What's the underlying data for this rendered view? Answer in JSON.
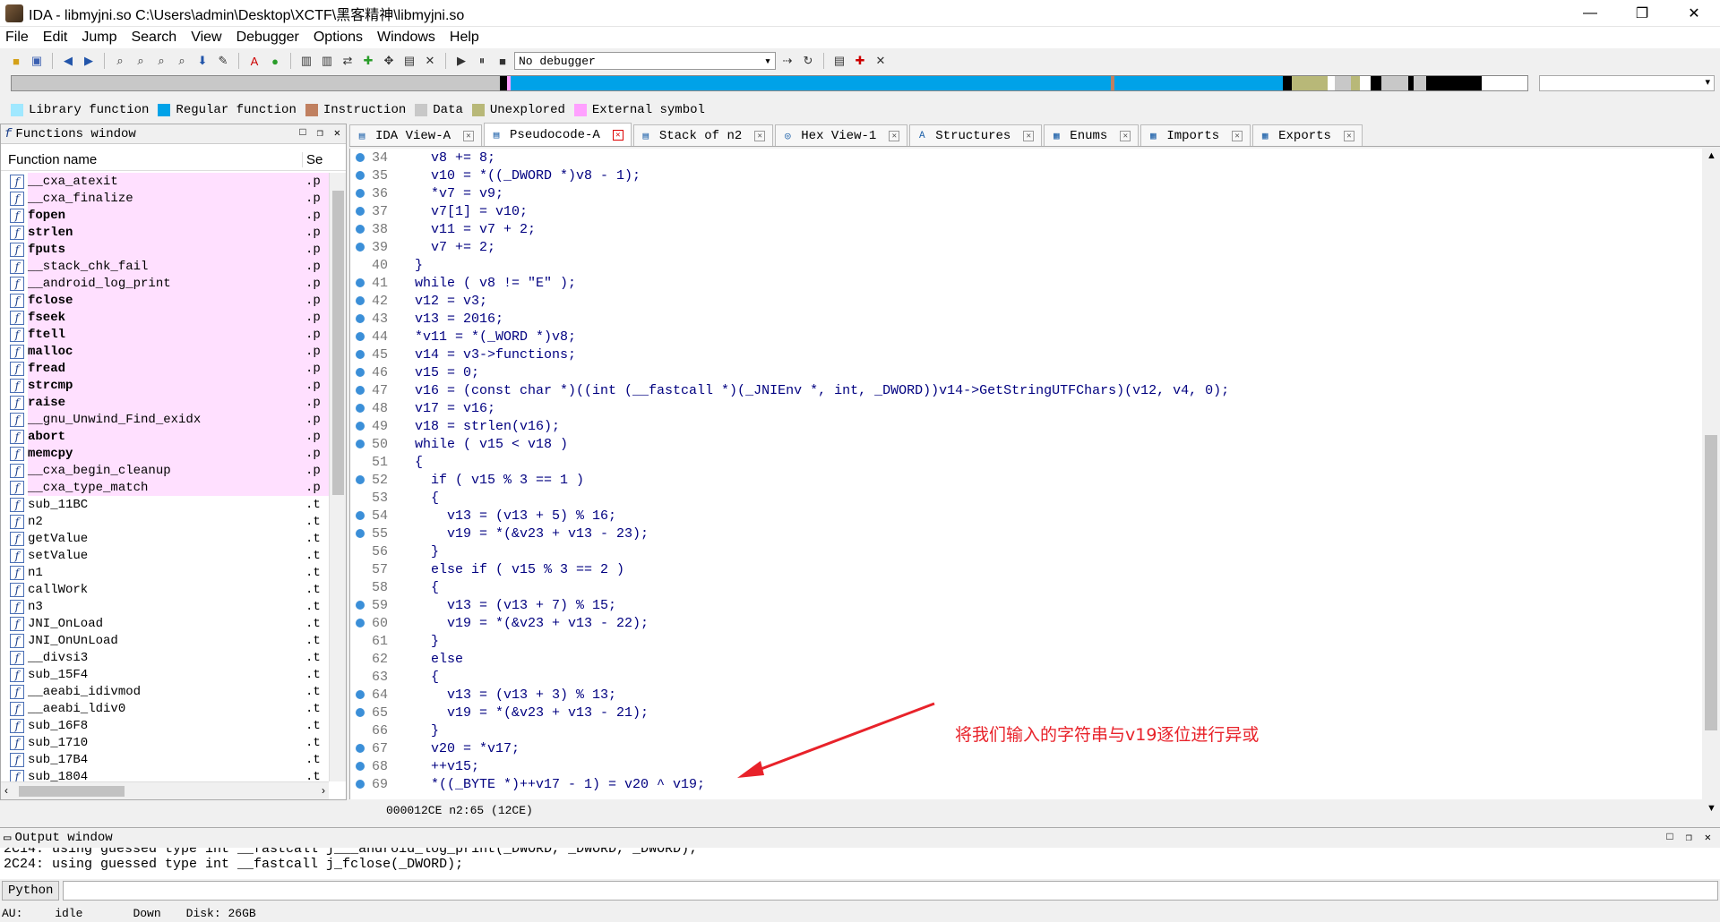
{
  "window": {
    "title": "IDA - libmyjni.so C:\\Users\\admin\\Desktop\\XCTF\\黑客精神\\libmyjni.so",
    "minimize": "—",
    "maximize": "❐",
    "close": "✕"
  },
  "menu": [
    "File",
    "Edit",
    "Jump",
    "Search",
    "View",
    "Debugger",
    "Options",
    "Windows",
    "Help"
  ],
  "toolbar": {
    "debugger_value": "No debugger"
  },
  "nav_selector": "▾",
  "legend": [
    {
      "label": "Library function",
      "color": "#a0e8ff"
    },
    {
      "label": "Regular function",
      "color": "#00a2e8"
    },
    {
      "label": "Instruction",
      "color": "#c08060"
    },
    {
      "label": "Data",
      "color": "#c8c8c8"
    },
    {
      "label": "Unexplored",
      "color": "#b8b878"
    },
    {
      "label": "External symbol",
      "color": "#ffa0ff"
    }
  ],
  "functions_window": {
    "title": "Functions window",
    "col_name": "Function name",
    "col_seg": "Se",
    "items": [
      {
        "name": "__cxa_atexit",
        "seg": ".p",
        "imp": true,
        "bold": false
      },
      {
        "name": "__cxa_finalize",
        "seg": ".p",
        "imp": true,
        "bold": false
      },
      {
        "name": "fopen",
        "seg": ".p",
        "imp": true,
        "bold": true
      },
      {
        "name": "strlen",
        "seg": ".p",
        "imp": true,
        "bold": true
      },
      {
        "name": "fputs",
        "seg": ".p",
        "imp": true,
        "bold": true
      },
      {
        "name": "__stack_chk_fail",
        "seg": ".p",
        "imp": true,
        "bold": false
      },
      {
        "name": "__android_log_print",
        "seg": ".p",
        "imp": true,
        "bold": false
      },
      {
        "name": "fclose",
        "seg": ".p",
        "imp": true,
        "bold": true
      },
      {
        "name": "fseek",
        "seg": ".p",
        "imp": true,
        "bold": true
      },
      {
        "name": "ftell",
        "seg": ".p",
        "imp": true,
        "bold": true
      },
      {
        "name": "malloc",
        "seg": ".p",
        "imp": true,
        "bold": true
      },
      {
        "name": "fread",
        "seg": ".p",
        "imp": true,
        "bold": true
      },
      {
        "name": "strcmp",
        "seg": ".p",
        "imp": true,
        "bold": true
      },
      {
        "name": "raise",
        "seg": ".p",
        "imp": true,
        "bold": true
      },
      {
        "name": "__gnu_Unwind_Find_exidx",
        "seg": ".p",
        "imp": true,
        "bold": false
      },
      {
        "name": "abort",
        "seg": ".p",
        "imp": true,
        "bold": true
      },
      {
        "name": "memcpy",
        "seg": ".p",
        "imp": true,
        "bold": true
      },
      {
        "name": "__cxa_begin_cleanup",
        "seg": ".p",
        "imp": true,
        "bold": false
      },
      {
        "name": "__cxa_type_match",
        "seg": ".p",
        "imp": true,
        "bold": false
      },
      {
        "name": "sub_11BC",
        "seg": ".t",
        "imp": false,
        "bold": false
      },
      {
        "name": "n2",
        "seg": ".t",
        "imp": false,
        "bold": false
      },
      {
        "name": "getValue",
        "seg": ".t",
        "imp": false,
        "bold": false
      },
      {
        "name": "setValue",
        "seg": ".t",
        "imp": false,
        "bold": false
      },
      {
        "name": "n1",
        "seg": ".t",
        "imp": false,
        "bold": false
      },
      {
        "name": "callWork",
        "seg": ".t",
        "imp": false,
        "bold": false
      },
      {
        "name": "n3",
        "seg": ".t",
        "imp": false,
        "bold": false
      },
      {
        "name": "JNI_OnLoad",
        "seg": ".t",
        "imp": false,
        "bold": false
      },
      {
        "name": "JNI_OnUnLoad",
        "seg": ".t",
        "imp": false,
        "bold": false
      },
      {
        "name": "__divsi3",
        "seg": ".t",
        "imp": false,
        "bold": false
      },
      {
        "name": "sub_15F4",
        "seg": ".t",
        "imp": false,
        "bold": false
      },
      {
        "name": "__aeabi_idivmod",
        "seg": ".t",
        "imp": false,
        "bold": false
      },
      {
        "name": "__aeabi_ldiv0",
        "seg": ".t",
        "imp": false,
        "bold": false
      },
      {
        "name": "sub_16F8",
        "seg": ".t",
        "imp": false,
        "bold": false
      },
      {
        "name": "sub_1710",
        "seg": ".t",
        "imp": false,
        "bold": false
      },
      {
        "name": "sub_17B4",
        "seg": ".t",
        "imp": false,
        "bold": false
      },
      {
        "name": "sub_1804",
        "seg": ".t",
        "imp": false,
        "bold": false
      }
    ]
  },
  "tabs": [
    {
      "label": "IDA View-A",
      "icon": "▤",
      "active": false
    },
    {
      "label": "Pseudocode-A",
      "icon": "▤",
      "active": true
    },
    {
      "label": "Stack of n2",
      "icon": "▤",
      "active": false
    },
    {
      "label": "Hex View-1",
      "icon": "◎",
      "active": false
    },
    {
      "label": "Structures",
      "icon": "A",
      "active": false
    },
    {
      "label": "Enums",
      "icon": "▦",
      "active": false
    },
    {
      "label": "Imports",
      "icon": "▦",
      "active": false
    },
    {
      "label": "Exports",
      "icon": "▦",
      "active": false
    }
  ],
  "code": [
    {
      "n": "34",
      "dot": true,
      "t": "    v8 += 8;"
    },
    {
      "n": "35",
      "dot": true,
      "t": "    v10 = *((_DWORD *)v8 - 1);"
    },
    {
      "n": "36",
      "dot": true,
      "t": "    *v7 = v9;"
    },
    {
      "n": "37",
      "dot": true,
      "t": "    v7[1] = v10;"
    },
    {
      "n": "38",
      "dot": true,
      "t": "    v11 = v7 + 2;"
    },
    {
      "n": "39",
      "dot": true,
      "t": "    v7 += 2;"
    },
    {
      "n": "40",
      "dot": false,
      "t": "  }"
    },
    {
      "n": "41",
      "dot": true,
      "t": "  while ( v8 != \"E\" );"
    },
    {
      "n": "42",
      "dot": true,
      "t": "  v12 = v3;"
    },
    {
      "n": "43",
      "dot": true,
      "t": "  v13 = 2016;"
    },
    {
      "n": "44",
      "dot": true,
      "t": "  *v11 = *(_WORD *)v8;"
    },
    {
      "n": "45",
      "dot": true,
      "t": "  v14 = v3->functions;"
    },
    {
      "n": "46",
      "dot": true,
      "t": "  v15 = 0;"
    },
    {
      "n": "47",
      "dot": true,
      "t": "  v16 = (const char *)((int (__fastcall *)(_JNIEnv *, int, _DWORD))v14->GetStringUTFChars)(v12, v4, 0);"
    },
    {
      "n": "48",
      "dot": true,
      "t": "  v17 = v16;"
    },
    {
      "n": "49",
      "dot": true,
      "t": "  v18 = strlen(v16);"
    },
    {
      "n": "50",
      "dot": true,
      "t": "  while ( v15 < v18 )"
    },
    {
      "n": "51",
      "dot": false,
      "t": "  {"
    },
    {
      "n": "52",
      "dot": true,
      "t": "    if ( v15 % 3 == 1 )"
    },
    {
      "n": "53",
      "dot": false,
      "t": "    {"
    },
    {
      "n": "54",
      "dot": true,
      "t": "      v13 = (v13 + 5) % 16;"
    },
    {
      "n": "55",
      "dot": true,
      "t": "      v19 = *(&v23 + v13 - 23);"
    },
    {
      "n": "56",
      "dot": false,
      "t": "    }"
    },
    {
      "n": "57",
      "dot": false,
      "t": "    else if ( v15 % 3 == 2 )"
    },
    {
      "n": "58",
      "dot": false,
      "t": "    {"
    },
    {
      "n": "59",
      "dot": true,
      "t": "      v13 = (v13 + 7) % 15;"
    },
    {
      "n": "60",
      "dot": true,
      "t": "      v19 = *(&v23 + v13 - 22);"
    },
    {
      "n": "61",
      "dot": false,
      "t": "    }"
    },
    {
      "n": "62",
      "dot": false,
      "t": "    else"
    },
    {
      "n": "63",
      "dot": false,
      "t": "    {"
    },
    {
      "n": "64",
      "dot": true,
      "t": "      v13 = (v13 + 3) % 13;"
    },
    {
      "n": "65",
      "dot": true,
      "t": "      v19 = *(&v23 + v13 - 21);"
    },
    {
      "n": "66",
      "dot": false,
      "t": "    }"
    },
    {
      "n": "67",
      "dot": true,
      "t": "    v20 = *v17;"
    },
    {
      "n": "68",
      "dot": true,
      "t": "    ++v15;"
    },
    {
      "n": "69",
      "dot": true,
      "t": "    *((_BYTE *)++v17 - 1) = v20 ^ v19;"
    }
  ],
  "code_status": "000012CE n2:65 (12CE)",
  "annotation": "将我们输入的字符串与v19逐位进行异或",
  "output_window": {
    "title": "Output window",
    "lines": [
      "2C14: using guessed type int __fastcall j___android_log_print(_DWORD, _DWORD, _DWORD);",
      "2C24: using guessed type int __fastcall j_fclose(_DWORD);"
    ]
  },
  "python_button": "Python",
  "status": {
    "au": "AU:",
    "state": "idle",
    "dir": "Down",
    "disk": "Disk: 26GB"
  }
}
